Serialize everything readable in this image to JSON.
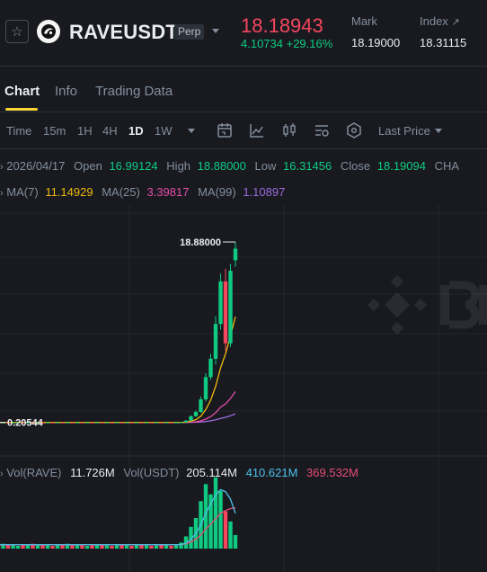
{
  "header": {
    "symbol": "RAVEUSDT",
    "contract_type": "Perp",
    "last_price": "18.18943",
    "change": "4.10734 +29.16%",
    "mark_label": "Mark",
    "mark_value": "18.19000",
    "index_label": "Index",
    "index_value": "18.31115",
    "colors": {
      "down": "#f6465d",
      "up": "#0ecb81"
    }
  },
  "tabs": [
    {
      "label": "Chart",
      "active": true
    },
    {
      "label": "Info",
      "active": false
    },
    {
      "label": "Trading Data",
      "active": false
    }
  ],
  "toolbar": {
    "timeframes": [
      "Time",
      "15m",
      "1H",
      "4H",
      "1D",
      "1W"
    ],
    "active_timeframe": "1D",
    "price_type": "Last Price"
  },
  "ohlc": {
    "date": "2026/04/17",
    "open_label": "Open",
    "open": "16.99124",
    "high_label": "High",
    "high": "18.88000",
    "low_label": "Low",
    "low": "16.31456",
    "close_label": "Close",
    "close": "18.19094",
    "change_label": "CHA"
  },
  "ma": {
    "ma7_label": "MA(7)",
    "ma7": "11.14929",
    "ma25_label": "MA(25)",
    "ma25": "3.39817",
    "ma99_label": "MA(99)",
    "ma99": "1.10897",
    "colors": {
      "ma7": "#f0b90b",
      "ma25": "#e64ca5",
      "ma99": "#9c6ade"
    }
  },
  "volume": {
    "label": "Vol(RAVE)",
    "rave_value": "11.726M",
    "usdt_label": "Vol(USDT)",
    "usdt_value": "205.114M",
    "ma5": "410.621M",
    "ma10": "369.532M",
    "colors": {
      "ma5": "#4fc1e9",
      "ma10": "#e64c77"
    }
  },
  "chart_data": {
    "type": "candlestick",
    "high_marker": "18.88000",
    "low_marker": "0.20544",
    "ylim": [
      0,
      20
    ],
    "candles": [
      {
        "o": 0.21,
        "h": 0.23,
        "l": 0.2,
        "c": 0.22
      },
      {
        "o": 0.22,
        "h": 0.24,
        "l": 0.21,
        "c": 0.21
      },
      {
        "o": 0.21,
        "h": 0.23,
        "l": 0.2,
        "c": 0.22
      },
      {
        "o": 0.22,
        "h": 0.23,
        "l": 0.21,
        "c": 0.21
      },
      {
        "o": 0.21,
        "h": 0.22,
        "l": 0.2,
        "c": 0.21
      },
      {
        "o": 0.21,
        "h": 0.23,
        "l": 0.2,
        "c": 0.22
      },
      {
        "o": 0.22,
        "h": 0.23,
        "l": 0.21,
        "c": 0.21
      },
      {
        "o": 0.21,
        "h": 0.22,
        "l": 0.2,
        "c": 0.22
      },
      {
        "o": 0.22,
        "h": 0.24,
        "l": 0.21,
        "c": 0.21
      },
      {
        "o": 0.21,
        "h": 0.23,
        "l": 0.2,
        "c": 0.22
      },
      {
        "o": 0.22,
        "h": 0.23,
        "l": 0.21,
        "c": 0.21
      },
      {
        "o": 0.21,
        "h": 0.22,
        "l": 0.2,
        "c": 0.22
      },
      {
        "o": 0.22,
        "h": 0.23,
        "l": 0.21,
        "c": 0.21
      },
      {
        "o": 0.21,
        "h": 0.23,
        "l": 0.2,
        "c": 0.22
      },
      {
        "o": 0.22,
        "h": 0.24,
        "l": 0.21,
        "c": 0.21
      },
      {
        "o": 0.21,
        "h": 0.22,
        "l": 0.2,
        "c": 0.22
      },
      {
        "o": 0.22,
        "h": 0.23,
        "l": 0.21,
        "c": 0.21
      },
      {
        "o": 0.21,
        "h": 0.23,
        "l": 0.2,
        "c": 0.22
      },
      {
        "o": 0.22,
        "h": 0.23,
        "l": 0.21,
        "c": 0.21
      },
      {
        "o": 0.21,
        "h": 0.22,
        "l": 0.2,
        "c": 0.22
      },
      {
        "o": 0.22,
        "h": 0.24,
        "l": 0.21,
        "c": 0.21
      },
      {
        "o": 0.21,
        "h": 0.23,
        "l": 0.2,
        "c": 0.22
      },
      {
        "o": 0.22,
        "h": 0.23,
        "l": 0.21,
        "c": 0.21
      },
      {
        "o": 0.21,
        "h": 0.22,
        "l": 0.2,
        "c": 0.22
      },
      {
        "o": 0.22,
        "h": 0.23,
        "l": 0.21,
        "c": 0.21
      },
      {
        "o": 0.21,
        "h": 0.23,
        "l": 0.2,
        "c": 0.22
      },
      {
        "o": 0.22,
        "h": 0.24,
        "l": 0.21,
        "c": 0.21
      },
      {
        "o": 0.21,
        "h": 0.22,
        "l": 0.2,
        "c": 0.22
      },
      {
        "o": 0.22,
        "h": 0.23,
        "l": 0.21,
        "c": 0.21
      },
      {
        "o": 0.21,
        "h": 0.23,
        "l": 0.2,
        "c": 0.22
      },
      {
        "o": 0.22,
        "h": 0.23,
        "l": 0.21,
        "c": 0.21
      },
      {
        "o": 0.21,
        "h": 0.22,
        "l": 0.2,
        "c": 0.22
      },
      {
        "o": 0.22,
        "h": 0.23,
        "l": 0.21,
        "c": 0.21
      },
      {
        "o": 0.21,
        "h": 0.24,
        "l": 0.2,
        "c": 0.22
      },
      {
        "o": 0.22,
        "h": 0.23,
        "l": 0.21,
        "c": 0.21
      },
      {
        "o": 0.21,
        "h": 0.23,
        "l": 0.2,
        "c": 0.22
      },
      {
        "o": 0.22,
        "h": 0.23,
        "l": 0.21,
        "c": 0.21
      },
      {
        "o": 0.21,
        "h": 0.22,
        "l": 0.2,
        "c": 0.22
      },
      {
        "o": 0.22,
        "h": 0.26,
        "l": 0.21,
        "c": 0.24
      },
      {
        "o": 0.24,
        "h": 0.45,
        "l": 0.22,
        "c": 0.4
      },
      {
        "o": 0.4,
        "h": 0.95,
        "l": 0.35,
        "c": 0.85
      },
      {
        "o": 0.85,
        "h": 1.45,
        "l": 0.8,
        "c": 1.3
      },
      {
        "o": 1.3,
        "h": 2.9,
        "l": 1.2,
        "c": 2.6
      },
      {
        "o": 2.6,
        "h": 5.3,
        "l": 2.4,
        "c": 4.9
      },
      {
        "o": 4.9,
        "h": 7.3,
        "l": 4.6,
        "c": 6.8
      },
      {
        "o": 6.8,
        "h": 11.2,
        "l": 6.2,
        "c": 10.4
      },
      {
        "o": 10.4,
        "h": 15.6,
        "l": 9.8,
        "c": 14.8
      },
      {
        "o": 14.8,
        "h": 16.1,
        "l": 7.6,
        "c": 8.4
      },
      {
        "o": 8.4,
        "h": 16.6,
        "l": 8.0,
        "c": 15.9
      },
      {
        "o": 16.99,
        "h": 18.88,
        "l": 16.31,
        "c": 18.19
      }
    ],
    "volumes": [
      6,
      5,
      7,
      5,
      6,
      4,
      6,
      5,
      7,
      5,
      6,
      5,
      4,
      6,
      5,
      7,
      5,
      6,
      5,
      4,
      6,
      5,
      5,
      6,
      4,
      5,
      6,
      5,
      4,
      5,
      6,
      5,
      4,
      6,
      5,
      5,
      4,
      6,
      9,
      18,
      32,
      45,
      70,
      95,
      80,
      105,
      85,
      55,
      40,
      20
    ],
    "ma7_curve": [
      0.21,
      0.21,
      0.21,
      0.21,
      0.21,
      0.21,
      0.21,
      0.21,
      0.21,
      0.21,
      0.21,
      0.21,
      0.21,
      0.21,
      0.21,
      0.21,
      0.21,
      0.21,
      0.21,
      0.21,
      0.21,
      0.21,
      0.21,
      0.21,
      0.21,
      0.21,
      0.21,
      0.21,
      0.21,
      0.21,
      0.21,
      0.21,
      0.21,
      0.21,
      0.21,
      0.21,
      0.21,
      0.21,
      0.22,
      0.25,
      0.34,
      0.5,
      0.86,
      1.54,
      2.52,
      3.95,
      5.87,
      7.3,
      9.14,
      11.15
    ],
    "ma25_curve": [
      0.21,
      0.21,
      0.21,
      0.21,
      0.21,
      0.21,
      0.21,
      0.21,
      0.21,
      0.21,
      0.21,
      0.21,
      0.21,
      0.21,
      0.21,
      0.21,
      0.21,
      0.21,
      0.21,
      0.21,
      0.21,
      0.21,
      0.21,
      0.21,
      0.21,
      0.21,
      0.21,
      0.21,
      0.21,
      0.21,
      0.21,
      0.21,
      0.21,
      0.21,
      0.21,
      0.21,
      0.21,
      0.21,
      0.21,
      0.22,
      0.24,
      0.28,
      0.38,
      0.56,
      0.82,
      1.22,
      1.8,
      2.12,
      2.7,
      3.4
    ],
    "ma99_curve": [
      0.21,
      0.21,
      0.21,
      0.21,
      0.21,
      0.21,
      0.21,
      0.21,
      0.21,
      0.21,
      0.21,
      0.21,
      0.21,
      0.21,
      0.21,
      0.21,
      0.21,
      0.21,
      0.21,
      0.21,
      0.21,
      0.21,
      0.21,
      0.21,
      0.21,
      0.21,
      0.21,
      0.21,
      0.21,
      0.21,
      0.21,
      0.21,
      0.21,
      0.21,
      0.21,
      0.21,
      0.21,
      0.21,
      0.21,
      0.21,
      0.22,
      0.23,
      0.26,
      0.31,
      0.38,
      0.48,
      0.62,
      0.74,
      0.9,
      1.11
    ],
    "vol_ma5_curve": [
      5.8,
      5.8,
      5.8,
      5.8,
      5.8,
      5.8,
      5.8,
      5.8,
      5.8,
      5.8,
      5.8,
      5.8,
      5.8,
      5.8,
      5.8,
      5.8,
      5.8,
      5.8,
      5.8,
      5.8,
      5.8,
      5.8,
      5.8,
      5.8,
      5.8,
      5.8,
      5.8,
      5.8,
      5.8,
      5.8,
      5.8,
      5.8,
      5.8,
      5.8,
      5.8,
      5.8,
      5.8,
      5.8,
      6,
      8,
      14,
      22,
      35,
      52,
      66,
      79,
      87,
      84,
      73,
      52
    ],
    "vol_ma10_curve": [
      5.6,
      5.6,
      5.6,
      5.6,
      5.6,
      5.6,
      5.6,
      5.6,
      5.6,
      5.6,
      5.6,
      5.6,
      5.6,
      5.6,
      5.6,
      5.6,
      5.6,
      5.6,
      5.6,
      5.6,
      5.6,
      5.6,
      5.6,
      5.6,
      5.6,
      5.6,
      5.6,
      5.6,
      5.6,
      5.6,
      5.6,
      5.6,
      5.6,
      5.6,
      5.6,
      5.6,
      5.6,
      5.6,
      5.9,
      7,
      10,
      14,
      20,
      29,
      36,
      44,
      52,
      56,
      59,
      60
    ]
  }
}
